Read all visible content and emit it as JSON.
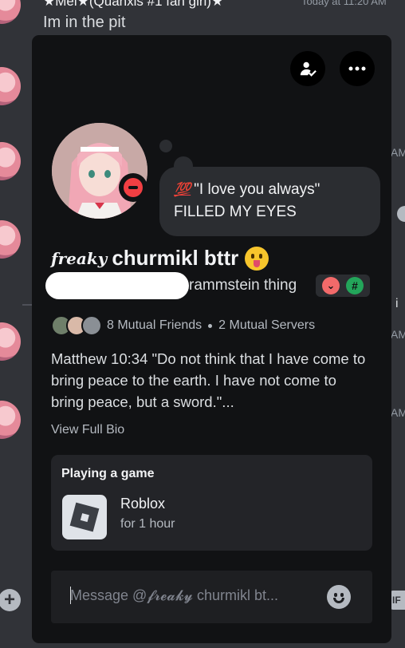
{
  "background": {
    "author": "★Mei★(Quanxis #1 fan girl)★",
    "timestamp": "Today at 11:20 AM",
    "message": "Im in the pit",
    "side_times": [
      "AM",
      "AM",
      "AM"
    ],
    "side_fragment": "i"
  },
  "popout": {
    "custom_status": {
      "emoji": "💯",
      "line1": "\"I love you always\"",
      "line2": "FILLED MY EYES"
    },
    "display_name_prefix": "freaky",
    "display_name": "churmikl bttr",
    "pronouns": "rammstein thing",
    "mutuals": {
      "friends": "8 Mutual Friends",
      "servers": "2 Mutual Servers"
    },
    "bio": "Matthew 10:34 \"Do not think that I have come to bring peace to the earth. I have not come to bring peace, but a sword.\"...",
    "view_full_bio": "View Full Bio",
    "activity": {
      "title": "Playing a game",
      "name": "Roblox",
      "duration": "for 1 hour"
    },
    "message_placeholder": "Message @𝓯𝓻𝓮𝓪𝓴𝔂 churmikl bt..."
  },
  "colors": {
    "popout_bg": "#111214",
    "status_dnd": "#f23f43",
    "accent_green": "#23a55a"
  }
}
